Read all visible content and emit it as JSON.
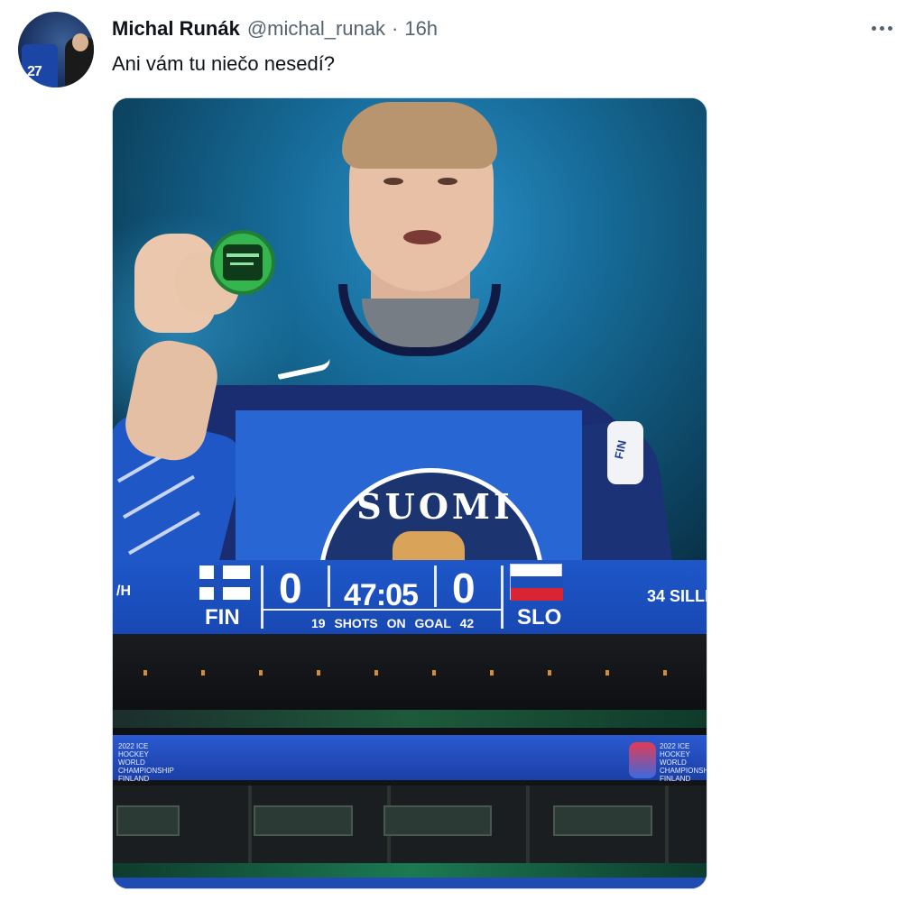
{
  "tweet": {
    "author_name": "Michal Runák",
    "handle": "@michal_runak",
    "separator": "·",
    "time": "16h",
    "text": "Ani vám tu niečo nesedí?"
  },
  "avatar": {
    "jersey_number": "27"
  },
  "image": {
    "jersey_text": "SUOMI",
    "sleeve_patch": "FIN",
    "scoreboard": {
      "left_fragment": "/H",
      "home_team": "FIN",
      "home_score": "0",
      "clock": "47:05",
      "away_score": "0",
      "away_team": "SLO",
      "home_shots": "19",
      "shots_label": "SHOTS ON GOAL",
      "away_shots": "42",
      "right_fragment": "34 SILLI"
    },
    "arena_text": "2022 ICE HOCKEY WORLD CHAMPIONSHIP FINLAND"
  },
  "colors": {
    "handle_gray": "#536471",
    "text_dark": "#0f1419",
    "scoreboard_blue": "#1e57c9",
    "slovenia_red": "#d92533"
  },
  "icons": {
    "more": "more-horizontal-icon"
  }
}
